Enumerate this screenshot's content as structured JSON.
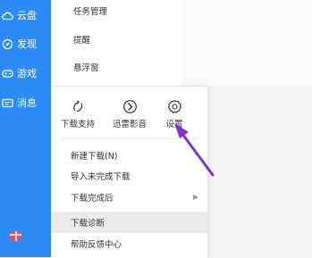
{
  "sidebar": {
    "items": [
      {
        "label": "云盘",
        "icon": "cloud-icon"
      },
      {
        "label": "发现",
        "icon": "discover-icon"
      },
      {
        "label": "游戏",
        "icon": "gamepad-icon"
      },
      {
        "label": "消息",
        "icon": "message-icon"
      }
    ],
    "bottom_icon": "gift-icon"
  },
  "settings_panel": {
    "items": [
      "任务管理",
      "提醒",
      "悬浮窗"
    ]
  },
  "menu": {
    "top_icons": [
      {
        "label": "下载支持",
        "icon": "download-support-icon"
      },
      {
        "label": "迅雷影音",
        "icon": "player-icon"
      },
      {
        "label": "设置",
        "icon": "gear-icon"
      }
    ],
    "items": [
      {
        "label": "新建下载(N)"
      },
      {
        "label": "导入未完成下载"
      },
      {
        "label": "下载完成后",
        "has_submenu": true
      },
      {
        "label": "下载诊断",
        "highlighted": true
      },
      {
        "label": "帮助反馈中心"
      }
    ]
  },
  "colors": {
    "sidebar_bg": "#2c8bf4",
    "annotation_arrow": "#7b33d6",
    "highlight_bg": "#ebebeb"
  }
}
